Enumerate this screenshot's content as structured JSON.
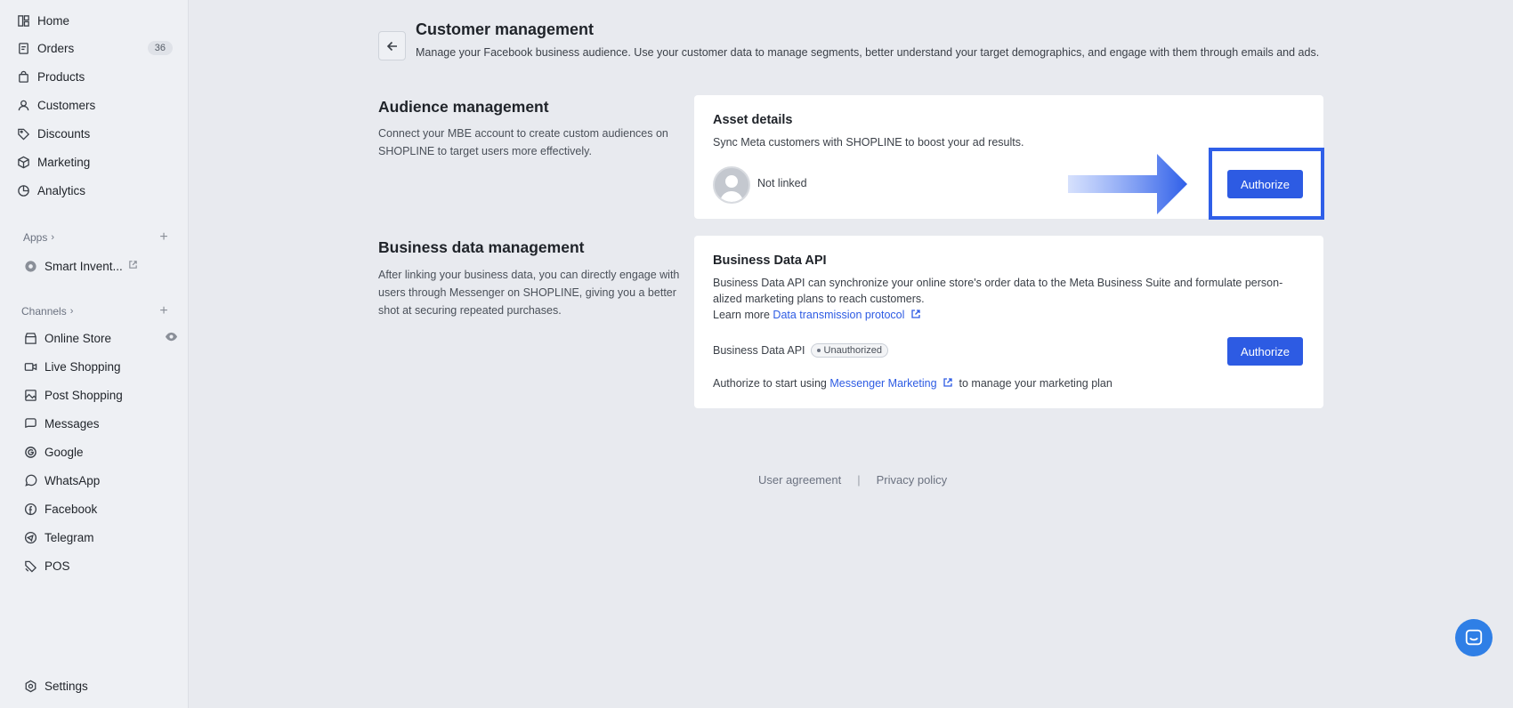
{
  "sidebar": {
    "items": [
      {
        "label": "Home",
        "icon": "home-icon"
      },
      {
        "label": "Orders",
        "icon": "orders-icon",
        "badge": "36"
      },
      {
        "label": "Products",
        "icon": "bag-icon"
      },
      {
        "label": "Customers",
        "icon": "user-icon"
      },
      {
        "label": "Discounts",
        "icon": "tag-icon"
      },
      {
        "label": "Marketing",
        "icon": "cube-icon"
      },
      {
        "label": "Analytics",
        "icon": "pie-chart-icon"
      }
    ],
    "apps_label": "Apps",
    "apps": [
      {
        "label": "Smart Invent...",
        "icon": "gear-app-icon"
      }
    ],
    "channels_label": "Channels",
    "channels": [
      {
        "label": "Online Store",
        "icon": "store-icon"
      },
      {
        "label": "Live Shopping",
        "icon": "video-icon"
      },
      {
        "label": "Post Shopping",
        "icon": "image-icon"
      },
      {
        "label": "Messages",
        "icon": "chat-icon"
      },
      {
        "label": "Google",
        "icon": "google-icon"
      },
      {
        "label": "WhatsApp",
        "icon": "whatsapp-icon"
      },
      {
        "label": "Facebook",
        "icon": "facebook-icon"
      },
      {
        "label": "Telegram",
        "icon": "telegram-icon"
      },
      {
        "label": "POS",
        "icon": "pos-icon"
      }
    ],
    "settings_label": "Settings"
  },
  "header": {
    "title": "Customer management",
    "description": "Manage your Facebook business audience. Use your customer data to manage segments, better understand your target demographics, and engage with them through emails and ads."
  },
  "audience": {
    "title": "Audience management",
    "description": "Connect your MBE account to create custom audiences on SHOPLINE to target users more effectively.",
    "card_title": "Asset details",
    "card_text": "Sync Meta customers with SHOPLINE to boost your ad results.",
    "status": "Not linked",
    "button": "Authorize"
  },
  "business": {
    "title": "Business data management",
    "description": "After linking your business data, you can directly engage with users through Messenger on SHOPLINE, giving you a better shot at securing repeated purchases.",
    "card_title": "Business Data API",
    "card_text_1": "Business Data API can synchronize your online store's order data to the Meta Business Suite and formulate person-alized marketing plans to reach customers.",
    "learn_more": "Learn more",
    "learn_link": "Data transmission protocol",
    "api_label": "Business Data API",
    "api_status": "Unauthorized",
    "button": "Authorize",
    "authorize_prefix": "Authorize to start using",
    "authorize_link": "Messenger Marketing",
    "authorize_suffix": "to manage your marketing plan"
  },
  "footer": {
    "user_agreement": "User agreement",
    "separator": "|",
    "privacy_policy": "Privacy policy"
  },
  "colors": {
    "primary": "#2d5be3",
    "highlight": "#2f5fe8",
    "background": "#e8eaef"
  }
}
